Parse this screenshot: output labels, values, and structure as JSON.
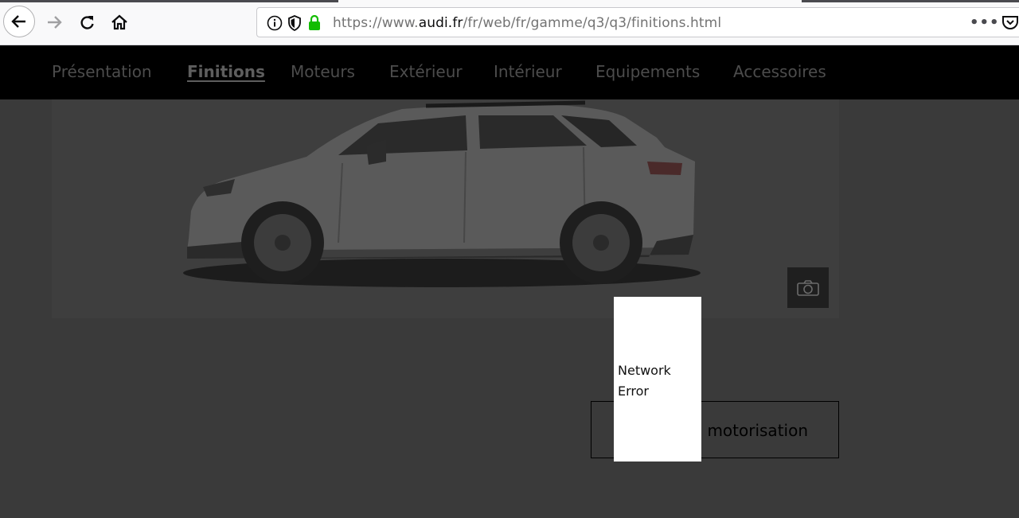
{
  "browser": {
    "url": {
      "prefix": "https://www.",
      "domain": "audi.fr",
      "path": "/fr/web/fr/gamme/q3/q3/finitions.html"
    },
    "icons": [
      "back-arrow-icon",
      "forward-arrow-icon",
      "reload-icon",
      "home-icon",
      "info-icon",
      "shield-icon",
      "lock-icon",
      "more-icon",
      "pocket-icon"
    ],
    "more_label": "•••"
  },
  "site_nav": {
    "items": [
      {
        "label": "Présentation",
        "active": false
      },
      {
        "label": "Finitions",
        "active": true
      },
      {
        "label": "Moteurs",
        "active": false
      },
      {
        "label": "Extérieur",
        "active": false
      },
      {
        "label": "Intérieur",
        "active": false
      },
      {
        "label": "Equipements",
        "active": false
      },
      {
        "label": "Accessoires",
        "active": false
      }
    ]
  },
  "content": {
    "cta_label": "motorisation",
    "error_line1": "Network",
    "error_line2": "Error"
  },
  "colors": {
    "overlay_bg": "#3a3a3a",
    "nav_bg": "#000000",
    "lock_green": "#12bc00"
  }
}
